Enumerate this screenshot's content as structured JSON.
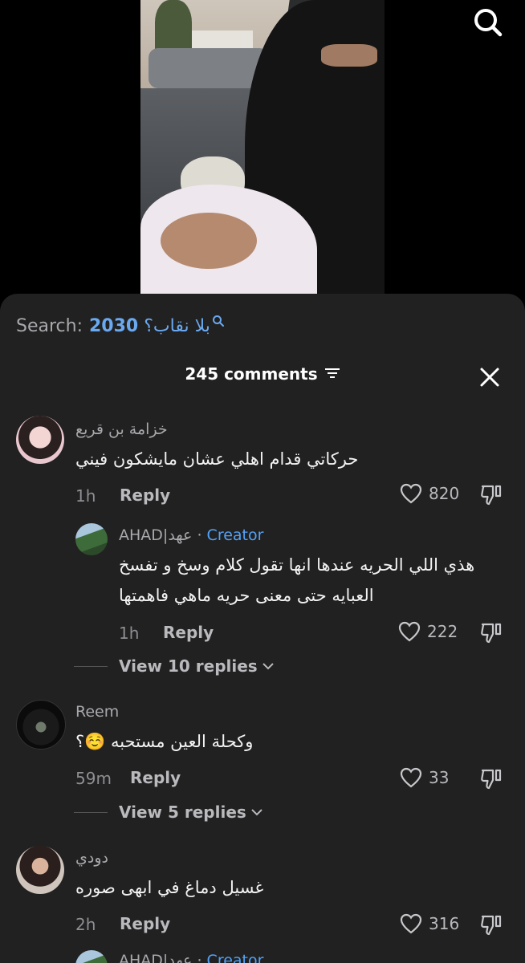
{
  "search": {
    "label": "Search:",
    "term_suffix": "بلا نقاب؟",
    "term_number": "2030"
  },
  "header": {
    "count_label": "245 comments"
  },
  "comments": [
    {
      "username": "خزامة بن قريع",
      "text": "حركاتي قدام اهلي عشان مايشكون فيني",
      "time": "1h",
      "reply": "Reply",
      "likes": "820"
    },
    {
      "username": "AHAD|عهد",
      "badge_sep": "·",
      "badge": "Creator",
      "text_line1": "هذي اللي الحريه عندها انها تقول كلام وسخ و تفسخ",
      "text_line2": "العبايه حتى معنى حريه ماهي فاهمتها",
      "time": "1h",
      "reply": "Reply",
      "likes": "222",
      "view_replies": "View 10 replies"
    },
    {
      "username": "Reem",
      "text": "وكحلة العين مستحبه ☺️؟",
      "time": "59m",
      "reply": "Reply",
      "likes": "33",
      "view_replies": "View 5 replies"
    },
    {
      "username": "دودي",
      "text": "غسيل دماغ في ابهى صوره",
      "time": "2h",
      "reply": "Reply",
      "likes": "316"
    },
    {
      "username": "AHAD|عهد",
      "badge_sep": "·",
      "badge": "Creator"
    }
  ],
  "colors": {
    "sheet_bg": "#212121",
    "accent_blue": "#52a2f7",
    "search_term": "#6aa9f0"
  },
  "icons": [
    "search-icon",
    "filter-icon",
    "close-icon",
    "heart-icon",
    "dislike-icon",
    "chevron-down-icon"
  ]
}
